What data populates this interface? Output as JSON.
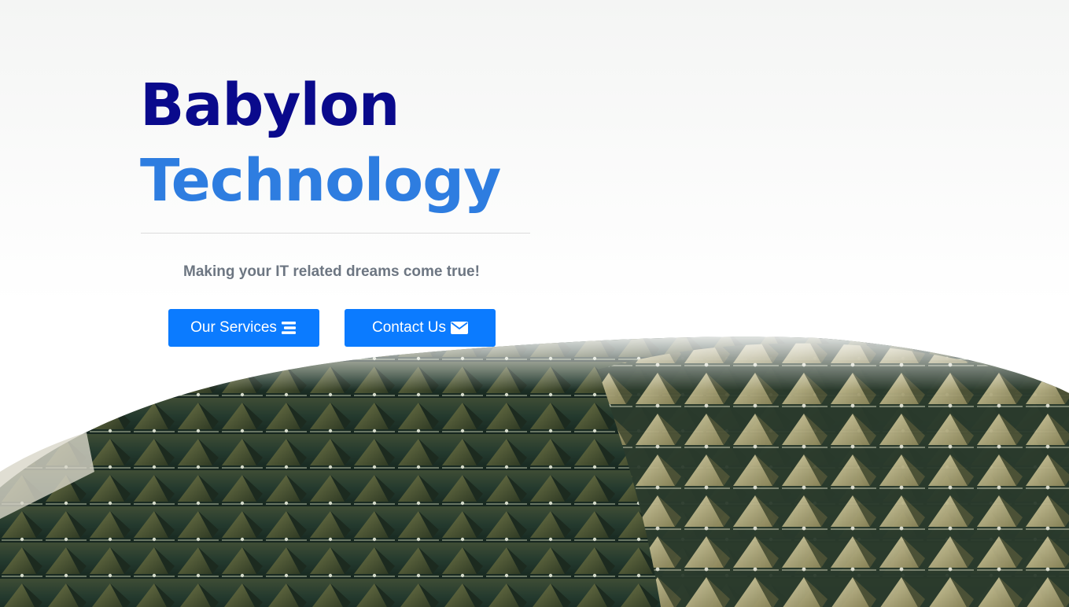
{
  "hero": {
    "title_line1": "Babylon",
    "title_line2": "Technology",
    "tagline": "Making your IT related dreams come true!"
  },
  "buttons": {
    "services_label": "Our Services",
    "services_icon": "bars-icon",
    "contact_label": "Contact Us",
    "contact_icon": "envelope-icon"
  },
  "colors": {
    "title_primary": "#0a0a8c",
    "title_accent": "#2e7de0",
    "button": "#0b7bff",
    "tagline": "#6d7682"
  }
}
